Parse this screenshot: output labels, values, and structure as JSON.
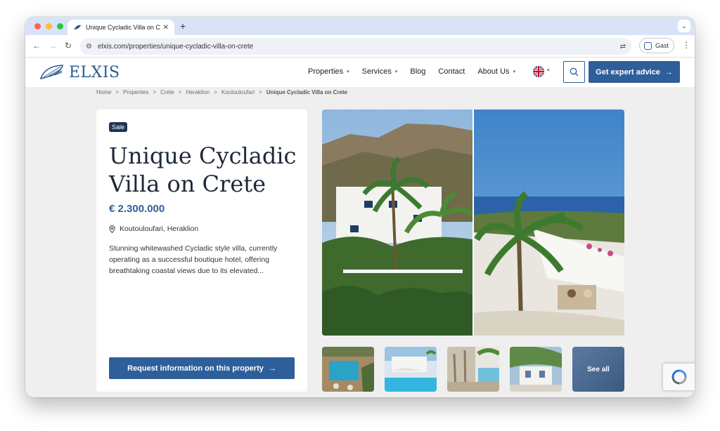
{
  "browser": {
    "tab_title": "Unique Cycladic Villa on Crete",
    "new_tab": "+",
    "close": "✕",
    "url": "elxis.com/properties/unique-cycladic-villa-on-crete",
    "profile_name": "Gast",
    "traffic_colors": [
      "#ff5f57",
      "#febc2e",
      "#28c840"
    ]
  },
  "site": {
    "logo": "ELXIS",
    "nav": [
      {
        "label": "Properties",
        "dropdown": true
      },
      {
        "label": "Services",
        "dropdown": true
      },
      {
        "label": "Blog",
        "dropdown": false
      },
      {
        "label": "Contact",
        "dropdown": false
      },
      {
        "label": "About Us",
        "dropdown": true
      }
    ],
    "cta": "Get expert advice",
    "brand_color": "#2f5f9a"
  },
  "breadcrumb": [
    "Home",
    "Properties",
    "Crete",
    "Heraklion",
    "Koutouloufari",
    "Unique Cycladic Villa on Crete"
  ],
  "property": {
    "badge": "Sale",
    "title": "Unique Cycladic Villa on Crete",
    "price": "€ 2.300.000",
    "location": "Koutouloufari, Heraklion",
    "description": "Stunning whitewashed Cycladic style villa, currently operating as a successful boutique hotel, offering breathtaking coastal views due to its elevated...",
    "request_button": "Request information on this property"
  },
  "gallery": {
    "see_all": "See all"
  }
}
